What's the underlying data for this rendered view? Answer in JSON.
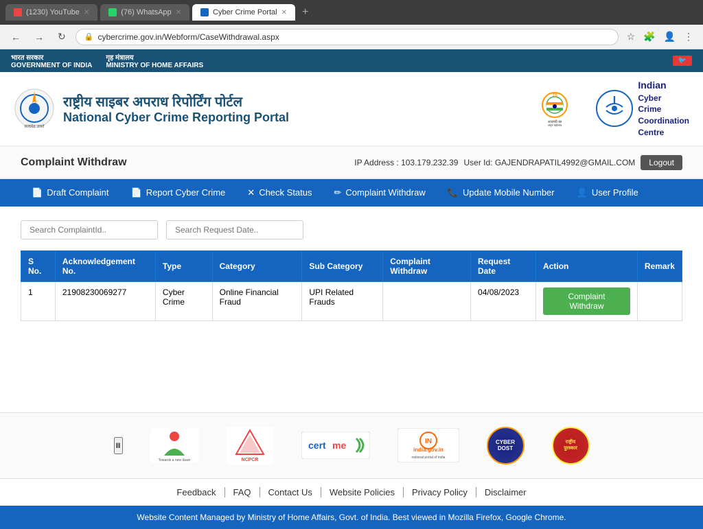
{
  "browser": {
    "tabs": [
      {
        "id": "tab-youtube",
        "label": "(1230) YouTube",
        "favicon_color": "#e44",
        "active": false
      },
      {
        "id": "tab-whatsapp",
        "label": "(76) WhatsApp",
        "favicon_color": "#25d366",
        "active": false
      },
      {
        "id": "tab-portal",
        "label": "Cyber Crime Portal",
        "favicon_color": "#1565c0",
        "active": true
      }
    ],
    "url": "cybercrime.gov.in/Webform/CaseWithdrawal.aspx",
    "url_display": "cybercrime.gov.in/Webform/CaseWithdrawal.aspx"
  },
  "gov_banner": {
    "left_line1": "भारत सरकार",
    "left_line2": "GOVERNMENT OF INDIA",
    "right_line1": "गृह मंत्रालय",
    "right_line2": "MINISTRY OF HOME AFFAIRS",
    "social": "🐦"
  },
  "site": {
    "title_hi": "राष्ट्रीय साइबर अपराध रिपोर्टिंग पोर्टल",
    "title_en": "National Cyber Crime Reporting Portal",
    "cyber_logo_lines": [
      "Indian",
      "Cyber",
      "Crime",
      "Coordination",
      "Centre"
    ],
    "amrit_text": "आज़ादी का\nअमृत महोत्सव"
  },
  "page": {
    "title": "Complaint Withdraw",
    "ip_label": "IP Address : 103.179.232.39",
    "user_label": "User Id: GAJENDRAPATIL4992@GMAIL.COM",
    "logout_label": "Logout"
  },
  "nav": {
    "items": [
      {
        "id": "draft-complaint",
        "icon": "📄",
        "label": "Draft Complaint"
      },
      {
        "id": "report-cyber-crime",
        "icon": "📄",
        "label": "Report Cyber Crime"
      },
      {
        "id": "check-status",
        "icon": "✕",
        "label": "Check Status"
      },
      {
        "id": "complaint-withdraw",
        "icon": "✏",
        "label": "Complaint Withdraw"
      },
      {
        "id": "update-mobile",
        "icon": "📞",
        "label": "Update Mobile Number"
      },
      {
        "id": "user-profile",
        "icon": "👤",
        "label": "User Profile"
      }
    ]
  },
  "search": {
    "complaint_id_placeholder": "Search ComplaintId..",
    "request_date_placeholder": "Search Request Date.."
  },
  "table": {
    "headers": [
      "S No.",
      "Acknowledgement No.",
      "Type",
      "Category",
      "Sub Category",
      "Complaint Withdraw",
      "Request Date",
      "Action",
      "Remark"
    ],
    "rows": [
      {
        "sno": "1",
        "ack_no": "21908230069277",
        "type": "Cyber Crime",
        "category": "Online Financial Fraud",
        "sub_category": "UPI Related Frauds",
        "complaint_withdraw": "",
        "request_date": "04/08/2023",
        "action_label": "Complaint Withdraw",
        "remark": ""
      }
    ]
  },
  "footer_links": [
    {
      "id": "feedback",
      "label": "Feedback"
    },
    {
      "id": "faq",
      "label": "FAQ"
    },
    {
      "id": "contact-us",
      "label": "Contact Us"
    },
    {
      "id": "website-policies",
      "label": "Website Policies"
    },
    {
      "id": "privacy-policy",
      "label": "Privacy Policy"
    },
    {
      "id": "disclaimer",
      "label": "Disclaimer"
    }
  ],
  "footer_bottom": "Website Content Managed by Ministry of Home Affairs, Govt. of India. Best viewed in Mozilla Firefox, Google Chrome.",
  "footer_logos": [
    {
      "id": "ncpcr",
      "label": "NCPCR"
    },
    {
      "id": "certme",
      "label": "certme"
    },
    {
      "id": "india-gov",
      "label": "india.gov.in"
    },
    {
      "id": "cyber-badge",
      "label": "CYBER"
    },
    {
      "id": "rashtriya",
      "label": "Rashtriya"
    }
  ]
}
